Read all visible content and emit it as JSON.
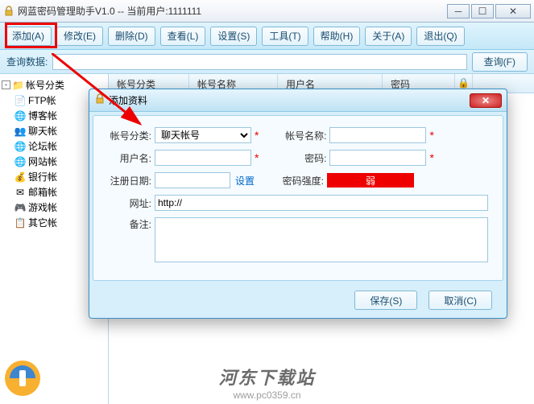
{
  "window": {
    "title": "网蓝密码管理助手V1.0 -- 当前用户:1111111"
  },
  "toolbar": {
    "add": "添加(A)",
    "edit": "修改(E)",
    "delete": "删除(D)",
    "view": "查看(L)",
    "settings": "设置(S)",
    "tools": "工具(T)",
    "help": "帮助(H)",
    "about": "关于(A)",
    "exit": "退出(Q)"
  },
  "search": {
    "label": "查询数据:",
    "value": "",
    "button": "查询(F)"
  },
  "tree": {
    "root": "帐号分类",
    "items": [
      {
        "icon": "📄",
        "label": "FTP帐"
      },
      {
        "icon": "🌐",
        "label": "博客帐"
      },
      {
        "icon": "👥",
        "label": "聊天帐"
      },
      {
        "icon": "🌐",
        "label": "论坛帐"
      },
      {
        "icon": "🌐",
        "label": "网站帐"
      },
      {
        "icon": "💰",
        "label": "银行帐"
      },
      {
        "icon": "✉",
        "label": "邮箱帐"
      },
      {
        "icon": "🎮",
        "label": "游戏帐"
      },
      {
        "icon": "📋",
        "label": "其它帐"
      }
    ]
  },
  "list_columns": {
    "c1": "帐号分类",
    "c2": "帐号名称",
    "c3": "用户名",
    "c4": "密码"
  },
  "dialog": {
    "title": "添加资料",
    "category_label": "帐号分类:",
    "category_value": "聊天帐号",
    "name_label": "帐号名称:",
    "name_value": "",
    "user_label": "用户名:",
    "user_value": "",
    "password_label": "密码:",
    "password_value": "",
    "regdate_label": "注册日期:",
    "regdate_value": "",
    "regdate_set": "设置",
    "strength_label": "密码强度:",
    "strength_value": "弱",
    "url_label": "网址:",
    "url_value": "http://",
    "remark_label": "备注:",
    "remark_value": "",
    "save": "保存(S)",
    "cancel": "取消(C)"
  },
  "watermark": {
    "text": "河东下载站",
    "url": "www.pc0359.cn"
  }
}
